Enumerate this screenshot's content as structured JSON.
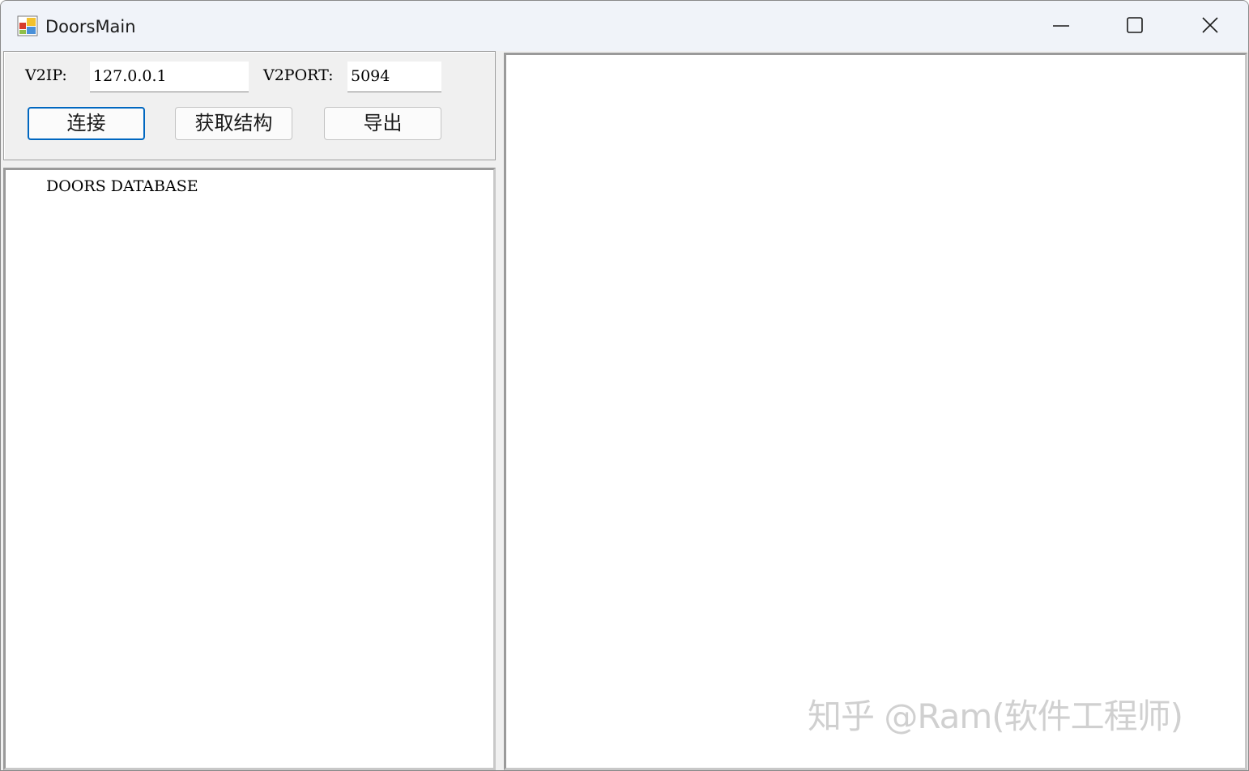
{
  "window": {
    "title": "DoorsMain"
  },
  "titlebar_buttons": {
    "minimize": "minimize-icon",
    "maximize": "maximize-icon",
    "close": "close-icon"
  },
  "connection": {
    "ip_label": "V2IP:",
    "ip_value": "127.0.0.1",
    "port_label": "V2PORT:",
    "port_value": "5094"
  },
  "toolbar": {
    "connect_label": "连接",
    "get_structure_label": "获取结构",
    "export_label": "导出"
  },
  "tree": {
    "items": [
      {
        "label": "DOORS DATABASE"
      }
    ]
  },
  "watermark": {
    "text": "知乎 @Ram(软件工程师)"
  },
  "colors": {
    "focus_accent": "#0067c0",
    "titlebar_bg": "#f0f3f9",
    "panel_bg": "#f0f0f0"
  }
}
